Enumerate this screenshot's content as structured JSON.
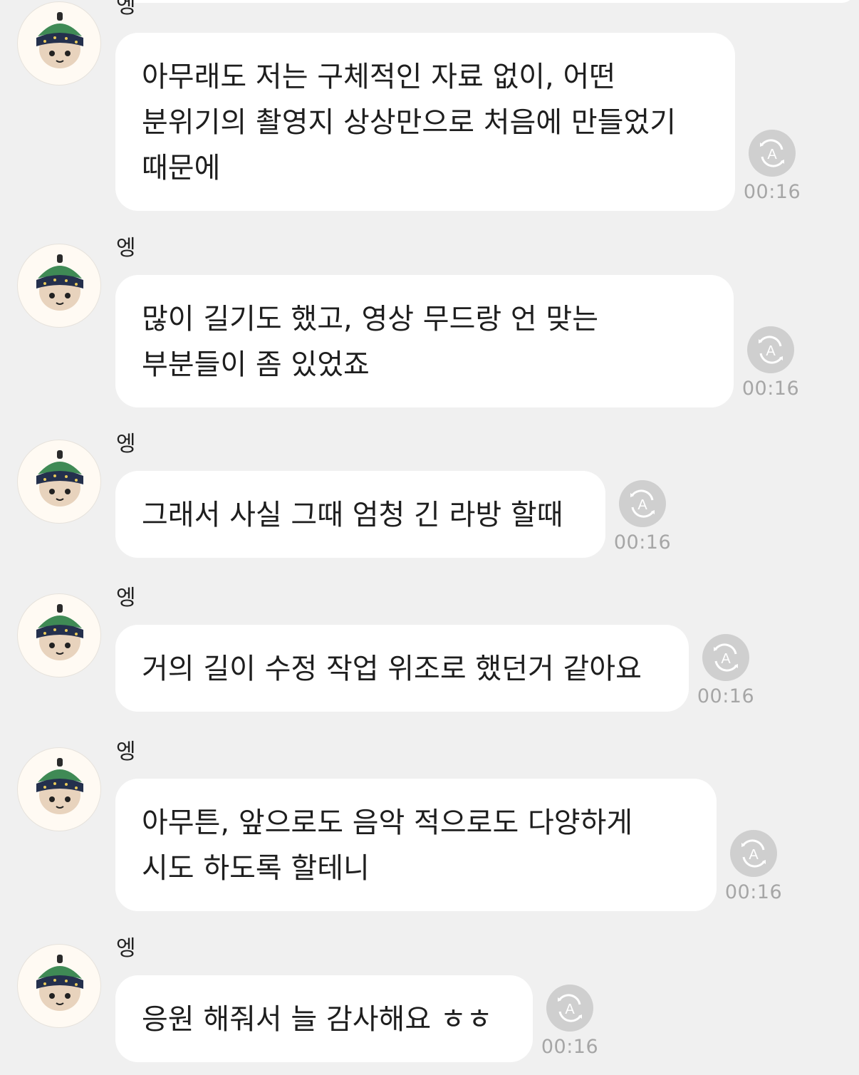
{
  "messages": [
    {
      "sender": "엥",
      "text": "아무래도 저는 구체적인 자료 없이, 어떤 분위기의 촬영지 상상만으로 처음에 만들었기 때문에",
      "time": "00:16",
      "translate_icon": "auto-translate-icon"
    },
    {
      "sender": "엥",
      "text": "많이 길기도 했고, 영상 무드랑 언 맞는 부분들이 좀 있었죠",
      "time": "00:16",
      "translate_icon": "auto-translate-icon"
    },
    {
      "sender": "엥",
      "text": "그래서 사실 그때 엄청 긴 라방 할때",
      "time": "00:16",
      "translate_icon": "auto-translate-icon"
    },
    {
      "sender": "엥",
      "text": "거의 길이 수정 작업 위조로 했던거 같아요",
      "time": "00:16",
      "translate_icon": "auto-translate-icon"
    },
    {
      "sender": "엥",
      "text": "아무튼, 앞으로도 음악 적으로도 다양하게 시도 하도록 할테니",
      "time": "00:16",
      "translate_icon": "auto-translate-icon"
    },
    {
      "sender": "엥",
      "text": "응원 해줘서 늘 감사해요 ㅎㅎ",
      "time": "00:16",
      "translate_icon": "auto-translate-icon"
    }
  ],
  "colors": {
    "background": "#f0f0f0",
    "bubble": "#ffffff",
    "text": "#1e1e1e",
    "time": "#a6a6a6",
    "translate_button": "#cfcfcf"
  },
  "avatar_icon": "plush-character-avatar"
}
